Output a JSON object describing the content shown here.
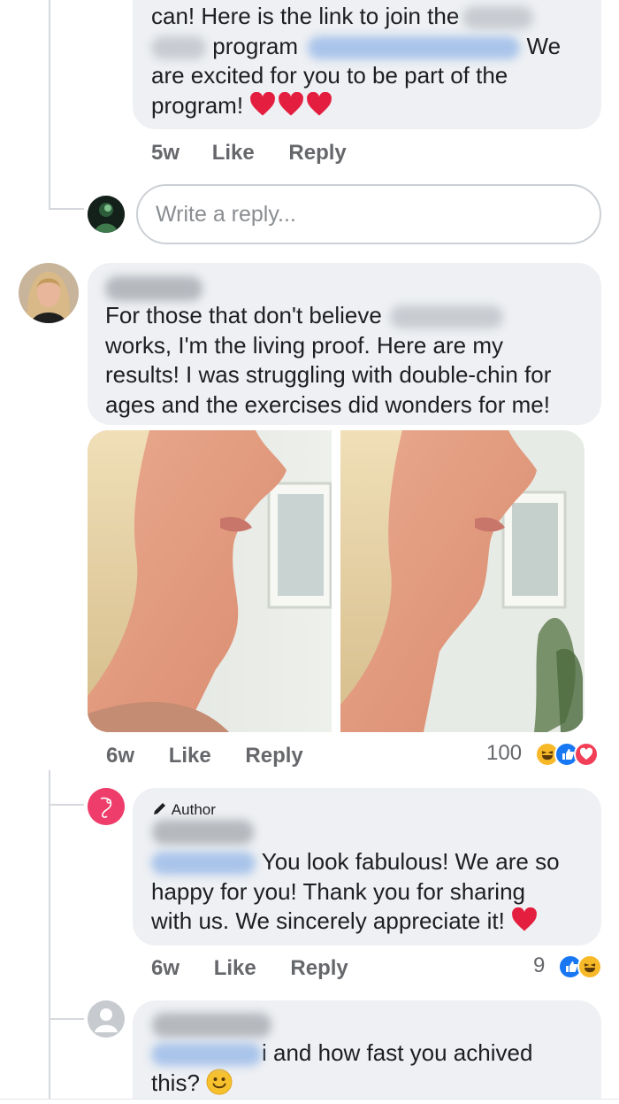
{
  "comment1": {
    "line1": "can! Here is the link to join the",
    "line2_a": "program",
    "line2_b": "We",
    "line3": "are excited for you to be part of the",
    "line4": "program!",
    "time": "5w",
    "like": "Like",
    "reply": "Reply"
  },
  "reply_input": {
    "placeholder": "Write a reply..."
  },
  "comment2": {
    "line1": "For those that don't believe",
    "line2": "works, I'm the living proof. Here are my",
    "line3": "results! I was struggling with double-chin for",
    "line4": "ages and the exercises did wonders for me!",
    "time": "6w",
    "like": "Like",
    "reply": "Reply",
    "reaction_count": "100"
  },
  "comment3": {
    "badge": "Author",
    "line1": "You look fabulous! We are so",
    "line2": "happy for you! Thank you for sharing",
    "line3": "with us. We sincerely appreciate it!",
    "time": "6w",
    "like": "Like",
    "reply": "Reply",
    "reaction_count": "9"
  },
  "comment4": {
    "line1": "i and how fast you achived",
    "line2": "this?"
  },
  "colors": {
    "bubble": "#eef0f3",
    "meta_text": "#65676b",
    "heart_red": "#e41e3f",
    "like_blue": "#1877f2",
    "haha_yellow": "#f7b928"
  },
  "icons": {
    "heart": "heart-icon",
    "like_reaction": "like-reaction-icon",
    "haha_reaction": "haha-reaction-icon",
    "love_reaction": "love-reaction-icon",
    "smile_emoji": "smile-emoji-icon",
    "pencil": "pencil-icon"
  }
}
